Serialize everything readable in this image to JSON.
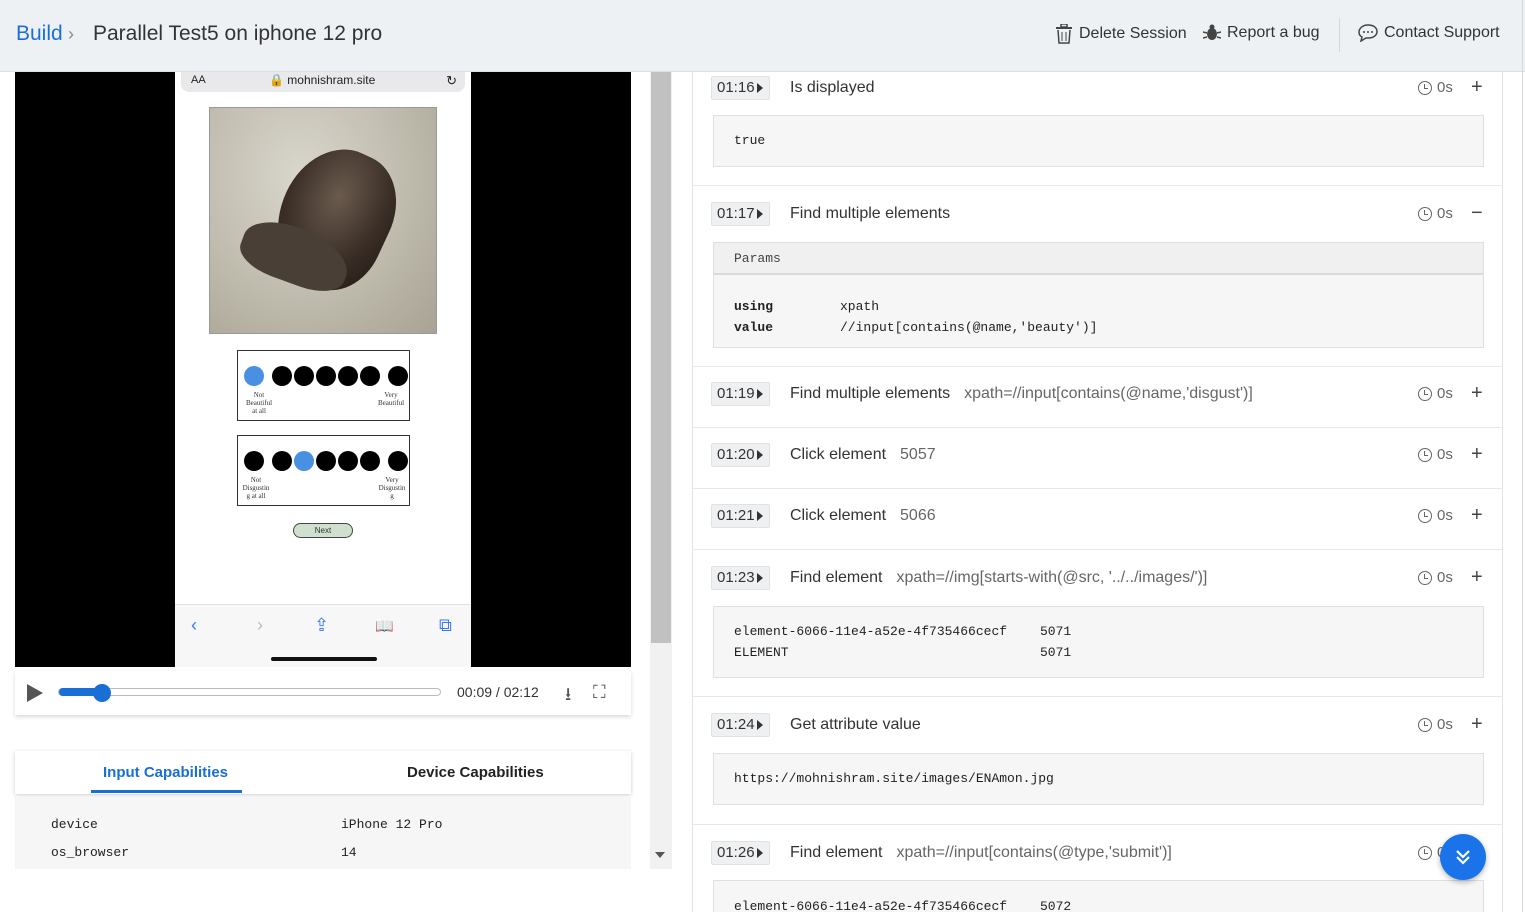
{
  "header": {
    "breadcrumb_build": "Build",
    "breadcrumb_sep": "›",
    "title": "Parallel Test5 on iphone 12 pro",
    "delete_session": "Delete Session",
    "report_bug": "Report a bug",
    "contact_support": "Contact Support"
  },
  "phone": {
    "text_size": "AA",
    "url": "🔒 mohnishram.site",
    "reload": "↻",
    "rating1": {
      "left_label": "Not Beautiful at all",
      "right_label": "Very Beautiful",
      "selected": 1
    },
    "rating2": {
      "left_label": "Not Disgustin g at all",
      "right_label": "Very Disgustin g",
      "selected": 3
    },
    "next_button": "Next",
    "toolbar": {
      "back": "‹",
      "forward": "›",
      "share": "⇪",
      "bookmarks": "📖",
      "tabs": "⧉"
    }
  },
  "player": {
    "time": "00:09 / 02:12",
    "progress_fraction": 0.045,
    "download": "⭳",
    "fullscreen": "⛶"
  },
  "capabilities": {
    "tab_input": "Input Capabilities",
    "tab_device": "Device Capabilities",
    "rows": [
      {
        "key": "device",
        "value": "iPhone 12 Pro"
      },
      {
        "key": "os_browser",
        "value": "14"
      }
    ]
  },
  "steps": [
    {
      "time": "01:16",
      "name": "Is displayed",
      "arg": "",
      "duration": "0s",
      "toggle": "+",
      "output": [
        "true"
      ]
    },
    {
      "time": "01:17",
      "name": "Find multiple elements",
      "arg": "",
      "duration": "0s",
      "toggle": "−",
      "params_title": "Params",
      "params": [
        {
          "k": "using",
          "v": "xpath"
        },
        {
          "k": "value",
          "v": "//input[contains(@name,'beauty')]"
        }
      ]
    },
    {
      "time": "01:19",
      "name": "Find multiple elements",
      "arg": "xpath=//input[contains(@name,'disgust')]",
      "duration": "0s",
      "toggle": "+"
    },
    {
      "time": "01:20",
      "name": "Click element",
      "arg": "5057",
      "duration": "0s",
      "toggle": "+"
    },
    {
      "time": "01:21",
      "name": "Click element",
      "arg": "5066",
      "duration": "0s",
      "toggle": "+"
    },
    {
      "time": "01:23",
      "name": "Find element",
      "arg": "xpath=//img[starts-with(@src, '../../images/')]",
      "duration": "0s",
      "toggle": "+",
      "kv": [
        {
          "k": "element-6066-11e4-a52e-4f735466cecf",
          "v": "5071"
        },
        {
          "k": "ELEMENT",
          "v": "5071"
        }
      ]
    },
    {
      "time": "01:24",
      "name": "Get attribute value",
      "arg": "",
      "duration": "0s",
      "toggle": "+",
      "output": [
        "https://mohnishram.site/images/ENAmon.jpg"
      ]
    },
    {
      "time": "01:26",
      "name": "Find element",
      "arg": "xpath=//input[contains(@type,'submit')]",
      "duration": "0s",
      "toggle": "+",
      "kv": [
        {
          "k": "element-6066-11e4-a52e-4f735466cecf",
          "v": "5072"
        }
      ]
    }
  ],
  "fab_icon": "⌄⌄",
  "colors": {
    "accent": "#1a6fd6",
    "fab": "#1a73e8",
    "topbar": "#eef1f4"
  }
}
